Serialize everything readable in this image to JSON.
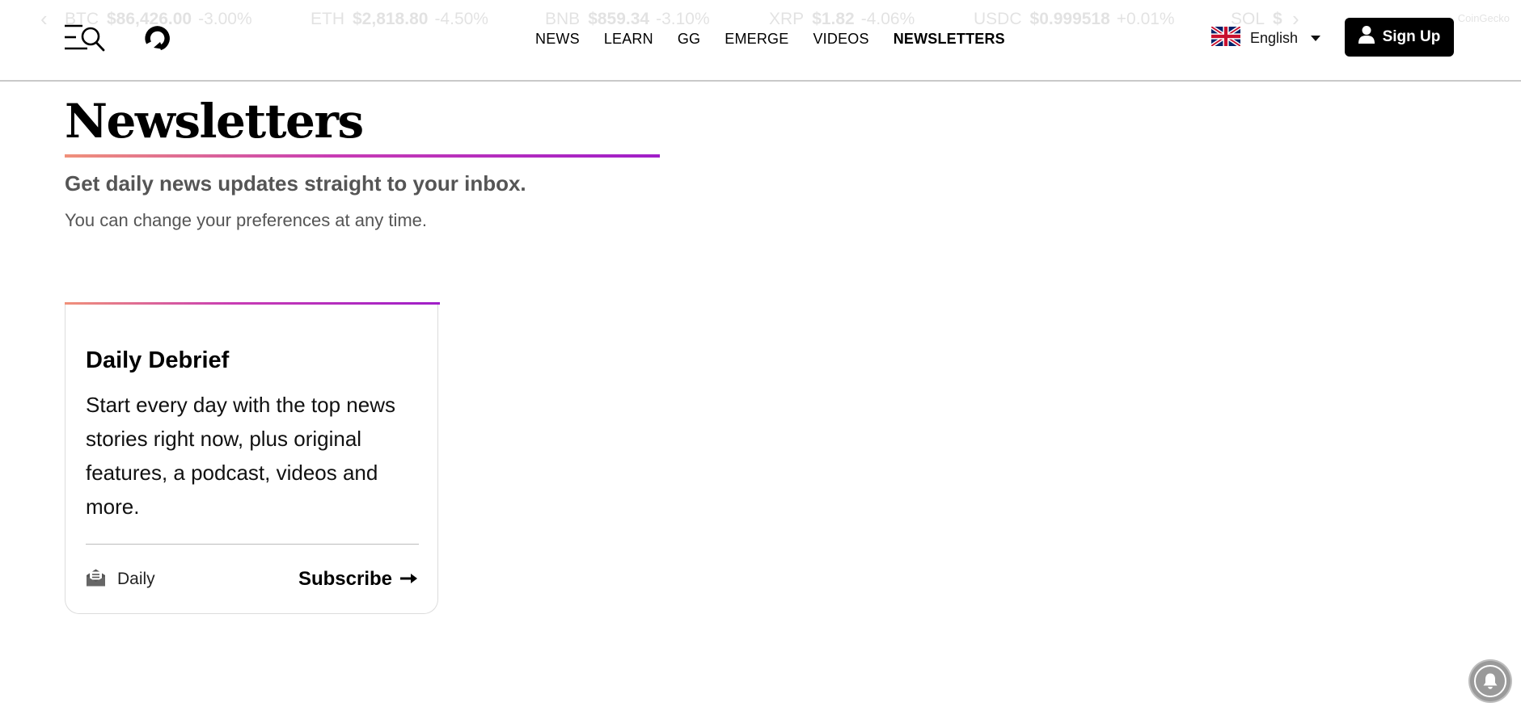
{
  "ticker": {
    "prev_arrow": "‹",
    "next_arrow": "›",
    "items": [
      {
        "symbol": "BTC",
        "price": "$86,426.00",
        "change": "-3.00%"
      },
      {
        "symbol": "ETH",
        "price": "$2,818.80",
        "change": "-4.50%"
      },
      {
        "symbol": "BNB",
        "price": "$859.34",
        "change": "-3.10%"
      },
      {
        "symbol": "XRP",
        "price": "$1.82",
        "change": "-4.06%"
      },
      {
        "symbol": "USDC",
        "price": "$0.999518",
        "change": "+0.01%"
      },
      {
        "symbol": "SOL",
        "price": "$",
        "change": ""
      }
    ],
    "credit": "CoinGecko"
  },
  "header": {
    "menu_icon": "menu-search-icon",
    "logo_icon": "decrypt-logo-icon",
    "nav": [
      {
        "label": "NEWS",
        "active": false
      },
      {
        "label": "LEARN",
        "active": false
      },
      {
        "label": "GG",
        "active": false
      },
      {
        "label": "EMERGE",
        "active": false
      },
      {
        "label": "VIDEOS",
        "active": false
      },
      {
        "label": "NEWSLETTERS",
        "active": true
      }
    ],
    "language": {
      "label": "English",
      "flag_icon": "uk-flag-icon"
    },
    "signup": {
      "label": "Sign Up",
      "icon": "user-icon"
    }
  },
  "main": {
    "title": "Newsletters",
    "subtitle": "Get daily news updates straight to your inbox.",
    "description": "You can change your preferences at any time."
  },
  "newsletters": [
    {
      "title": "Daily Debrief",
      "description": "Start every day with the top news stories right now, plus original features, a podcast, videos and more.",
      "frequency": "Daily",
      "frequency_icon": "mail-open-icon",
      "subscribe_label": "Subscribe",
      "subscribe_icon": "arrow-right-icon"
    }
  ],
  "colors": {
    "accent_gradient_start": "#f0917a",
    "accent_gradient_mid": "#c83cb4",
    "accent_gradient_end": "#a01ec8",
    "button_bg": "#000000",
    "muted_text": "#555555"
  },
  "notification": {
    "icon": "bell-icon"
  }
}
